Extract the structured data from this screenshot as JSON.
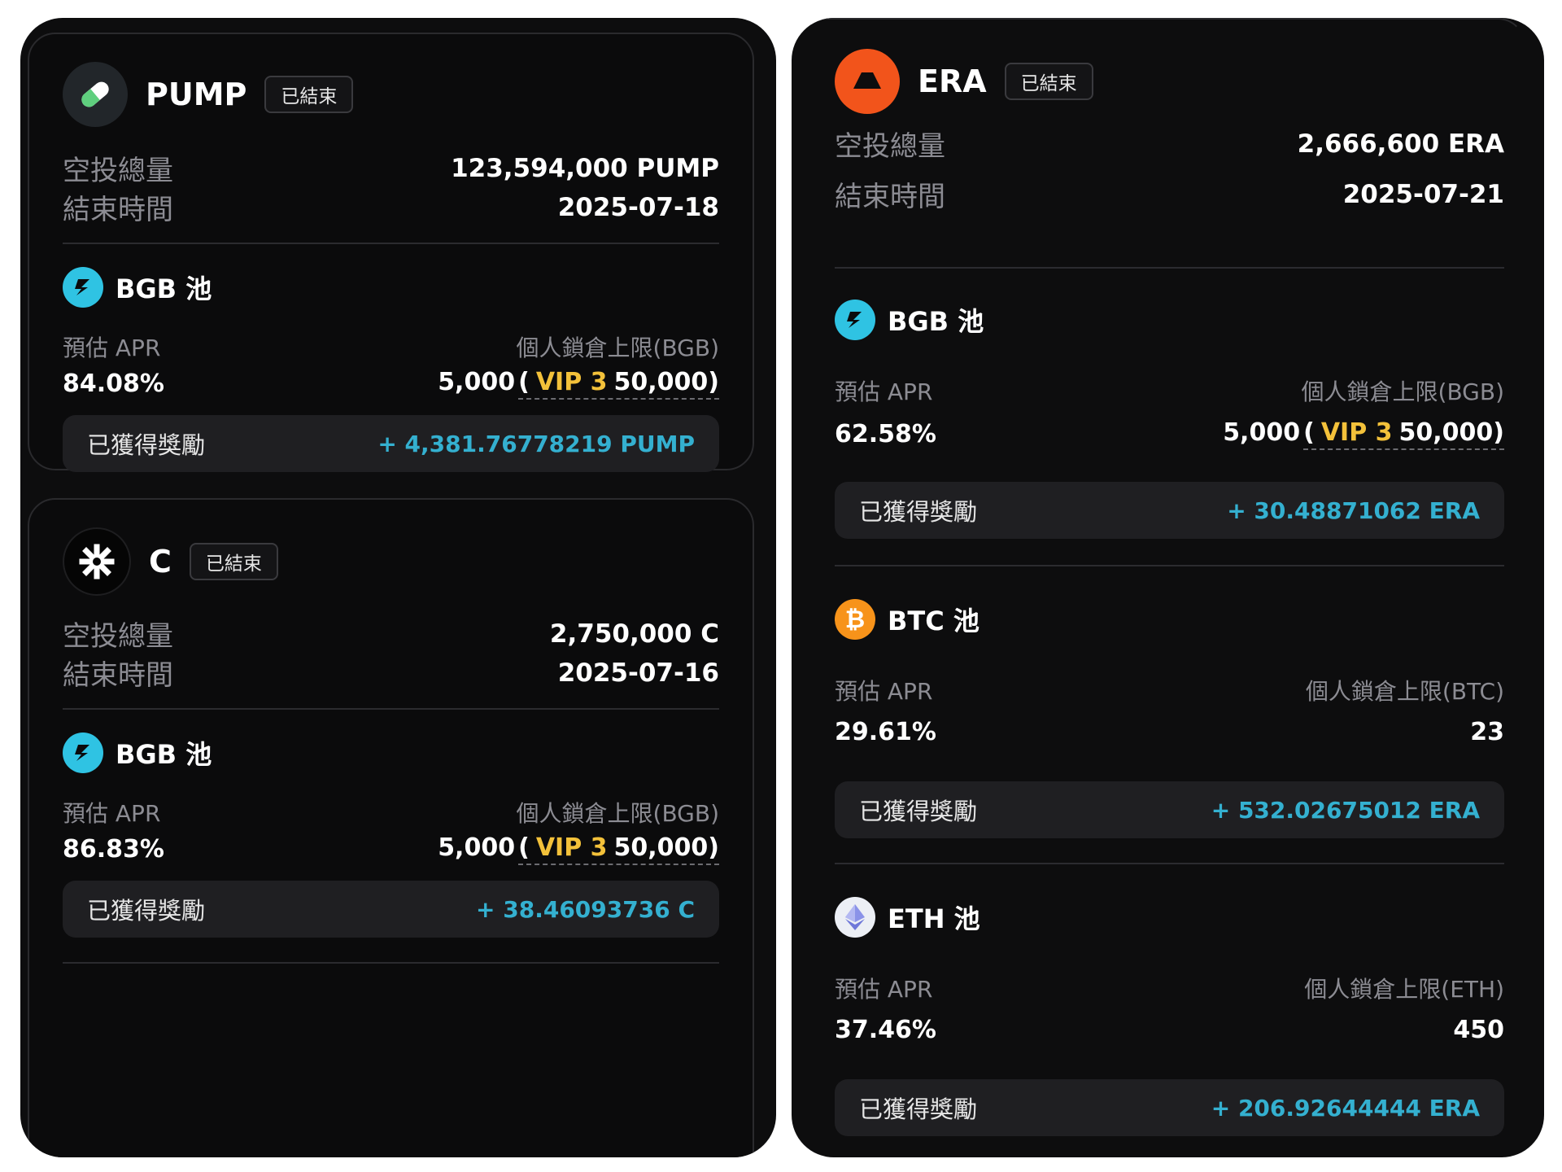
{
  "left": {
    "cards": [
      {
        "token": "PUMP",
        "status": "已結束",
        "total_label": "空投總量",
        "total_value": "123,594,000 PUMP",
        "end_label": "結束時間",
        "end_value": "2025-07-18",
        "pool": {
          "name": "BGB 池",
          "apr_label": "預估 APR",
          "apr_value": "84.08%",
          "cap_label": "個人鎖倉上限(BGB)",
          "cap_base": "5,000",
          "cap_open": "(",
          "cap_vip": "VIP 3",
          "cap_vip_value": "50,000",
          "cap_close": ")",
          "reward_label": "已獲得獎勵",
          "reward_value": "+ 4,381.76778219 PUMP"
        }
      },
      {
        "token": "C",
        "status": "已結束",
        "total_label": "空投總量",
        "total_value": "2,750,000 C",
        "end_label": "結束時間",
        "end_value": "2025-07-16",
        "pool": {
          "name": "BGB 池",
          "apr_label": "預估 APR",
          "apr_value": "86.83%",
          "cap_label": "個人鎖倉上限(BGB)",
          "cap_base": "5,000",
          "cap_open": "(",
          "cap_vip": "VIP 3",
          "cap_vip_value": "50,000",
          "cap_close": ")",
          "reward_label": "已獲得獎勵",
          "reward_value": "+ 38.46093736 C"
        }
      }
    ]
  },
  "right": {
    "token": "ERA",
    "status": "已結束",
    "total_label": "空投總量",
    "total_value": "2,666,600 ERA",
    "end_label": "結束時間",
    "end_value": "2025-07-21",
    "pools": [
      {
        "name": "BGB 池",
        "apr_label": "預估 APR",
        "apr_value": "62.58%",
        "cap_label": "個人鎖倉上限(BGB)",
        "cap_base": "5,000",
        "cap_open": "(",
        "cap_vip": "VIP 3",
        "cap_vip_value": "50,000",
        "cap_close": ")",
        "reward_label": "已獲得獎勵",
        "reward_value": "+ 30.48871062 ERA"
      },
      {
        "name": "BTC 池",
        "apr_label": "預估 APR",
        "apr_value": "29.61%",
        "cap_label": "個人鎖倉上限(BTC)",
        "cap_value": "23",
        "reward_label": "已獲得獎勵",
        "reward_value": "+ 532.02675012 ERA"
      },
      {
        "name": "ETH 池",
        "apr_label": "預估 APR",
        "apr_value": "37.46%",
        "cap_label": "個人鎖倉上限(ETH)",
        "cap_value": "450",
        "reward_label": "已獲得獎勵",
        "reward_value": "+ 206.92644444 ERA"
      }
    ]
  },
  "colors": {
    "accent_blue": "#34b0d0",
    "vip_gold": "#f3c13a",
    "label_gray": "#8c8c93",
    "era_orange": "#f2541b",
    "btc_orange": "#f7931a"
  },
  "icons": {
    "pump": "pill-icon",
    "c": "asterisk-logo-icon",
    "era": "era-logo-icon",
    "bgb": "bgb-icon",
    "btc": "bitcoin-icon",
    "eth": "ethereum-icon"
  }
}
